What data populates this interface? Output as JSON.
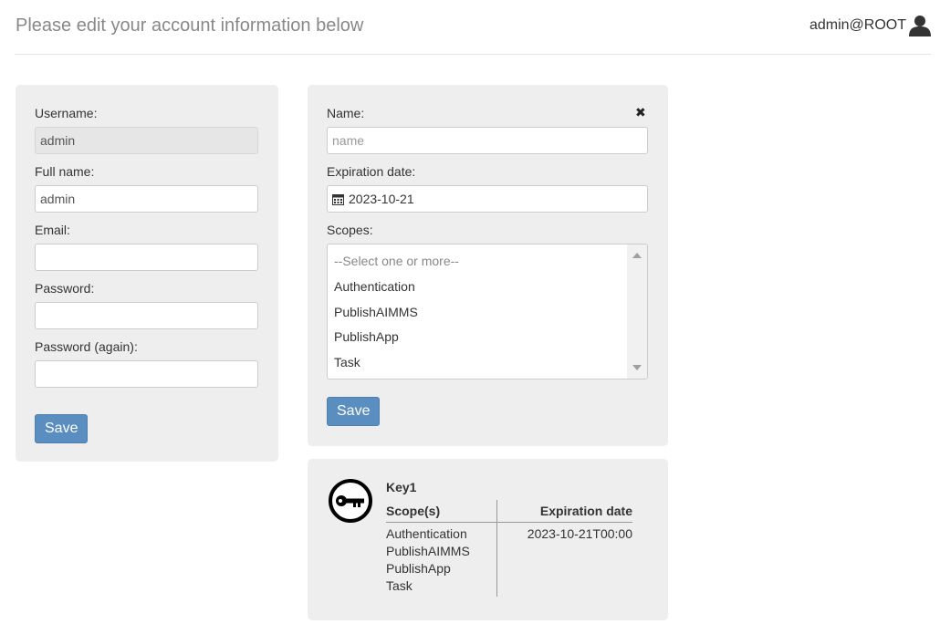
{
  "header": {
    "title": "Please edit your account information below",
    "user": "admin@ROOT",
    "user_icon": "user-icon"
  },
  "account_form": {
    "username_label": "Username:",
    "username_value": "admin",
    "fullname_label": "Full name:",
    "fullname_value": "admin",
    "email_label": "Email:",
    "email_value": "",
    "password_label": "Password:",
    "password_value": "",
    "password_again_label": "Password (again):",
    "password_again_value": "",
    "save_label": "Save"
  },
  "key_form": {
    "name_label": "Name:",
    "name_placeholder": "name",
    "close_glyph": "✖",
    "expiration_label": "Expiration date:",
    "expiration_value": "2023-10-21",
    "calendar_icon": "calendar-icon",
    "scopes_label": "Scopes:",
    "scopes_options": [
      "--Select one or more--",
      "Authentication",
      "PublishAIMMS",
      "PublishApp",
      "Task"
    ],
    "save_label": "Save"
  },
  "key_card": {
    "icon": "key-icon",
    "name": "Key1",
    "scopes_header": "Scope(s)",
    "expiration_header": "Expiration date",
    "scopes": [
      "Authentication",
      "PublishAIMMS",
      "PublishApp",
      "Task"
    ],
    "expiration": "2023-10-21T00:00"
  },
  "colors": {
    "accent": "#5b8ec0",
    "panel_bg": "#eeeeee",
    "header_text": "#888888"
  }
}
